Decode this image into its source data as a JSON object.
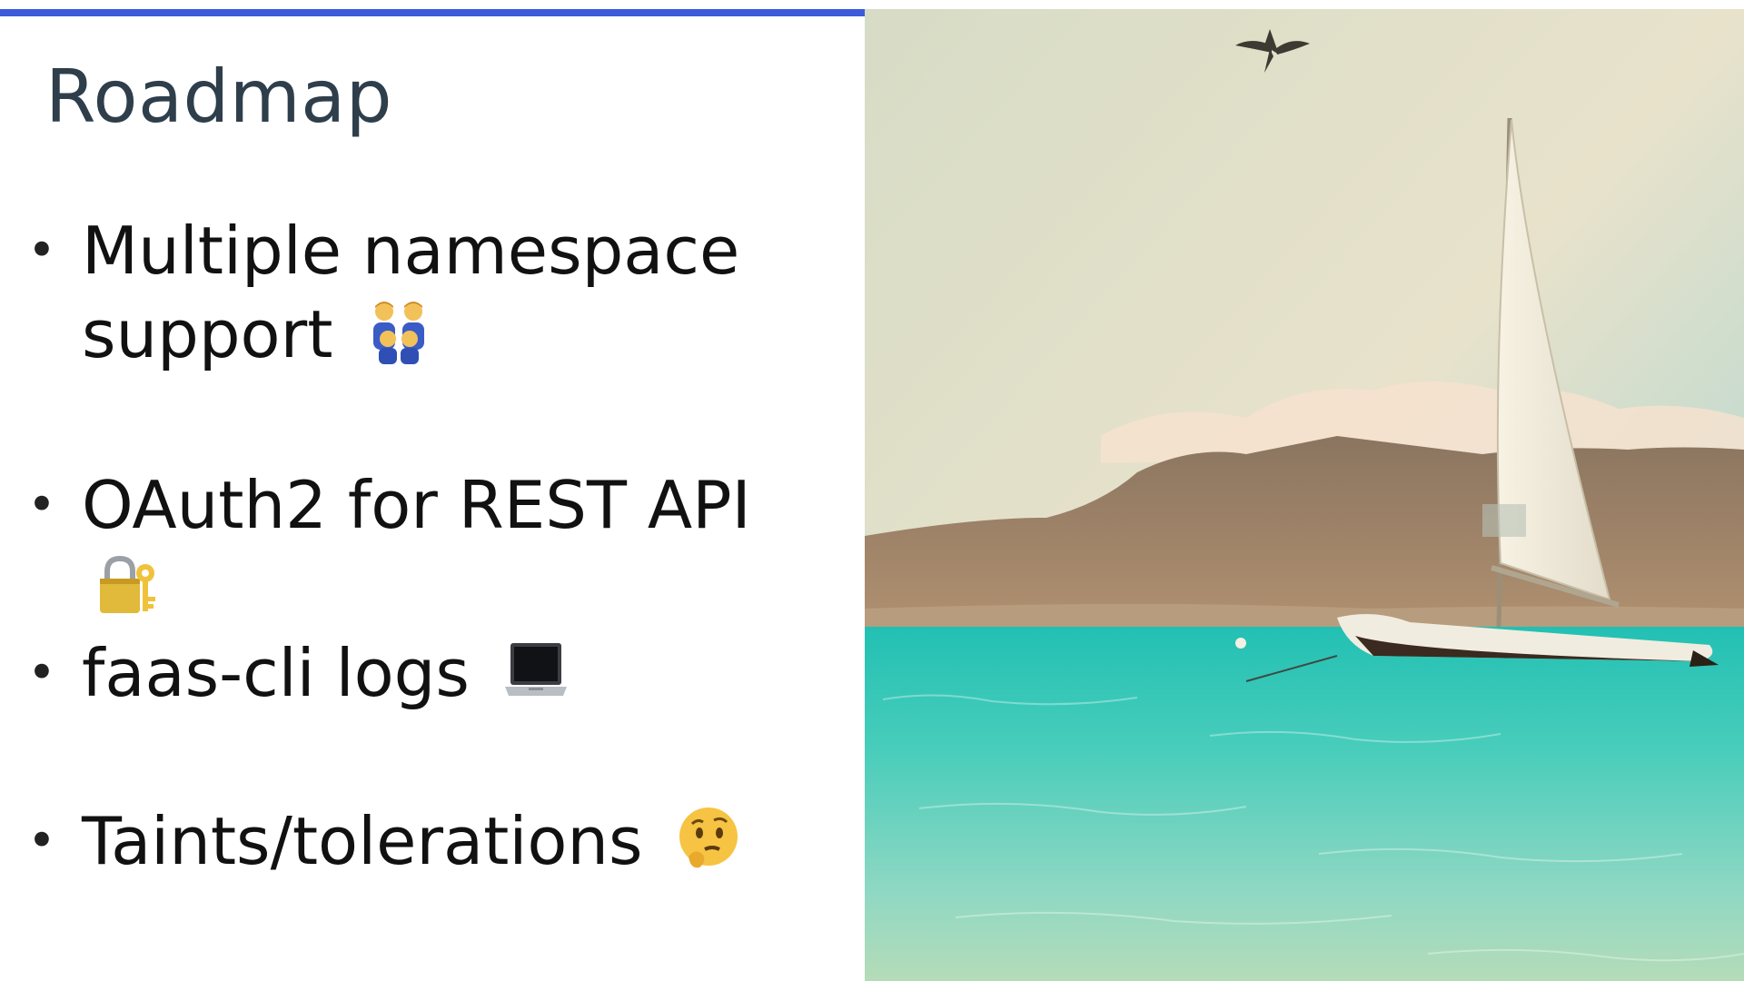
{
  "slide": {
    "title": "Roadmap",
    "accent_color": "#3b5bdb",
    "bullets": [
      {
        "text_line1": "Multiple namespace",
        "text_line2": "support",
        "emoji": "family-icon"
      },
      {
        "text_line1": "OAuth2 for REST API",
        "emoji": "lock-key-icon"
      },
      {
        "text_line1": "faas-cli logs",
        "emoji": "laptop-icon"
      },
      {
        "text_line1": "Taints/tolerations",
        "emoji": "thinking-face-icon"
      }
    ]
  },
  "photo": {
    "subject": "sailboat-photo"
  }
}
